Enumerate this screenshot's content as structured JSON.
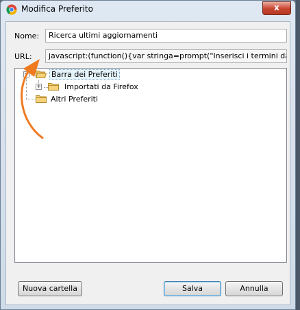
{
  "window": {
    "title": "Modifica Preferito",
    "close_glyph": "x"
  },
  "form": {
    "name_label": "Nome:",
    "name_value": "Ricerca ultimi aggiornamenti",
    "url_label": "URL:",
    "url_value": "javascript:(function(){var stringa=prompt(\"Inserisci i termini da ce"
  },
  "tree": {
    "items": [
      {
        "label": "Barra dei Preferiti",
        "expanded": true
      },
      {
        "label": "Importati da Firefox",
        "expanded": false
      },
      {
        "label": "Altri Preferiti"
      }
    ]
  },
  "buttons": {
    "new_folder": "Nuova cartella",
    "save": "Salva",
    "cancel": "Annulla"
  },
  "colors": {
    "arrow": "#f07a20",
    "folder": "#f6d27a"
  }
}
